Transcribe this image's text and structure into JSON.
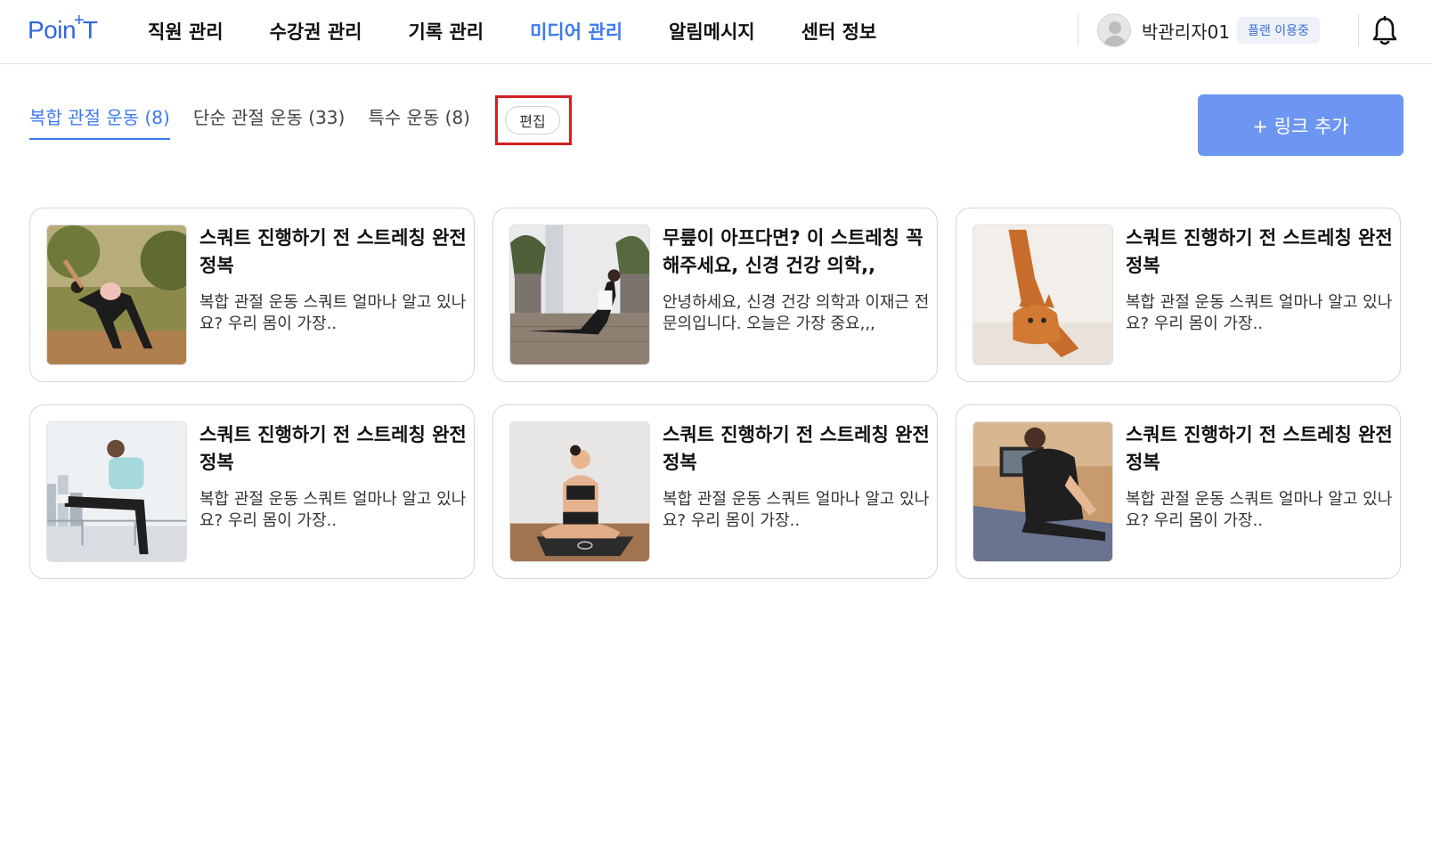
{
  "header": {
    "logo": {
      "left": "Poin",
      "plus": "+",
      "right": "T"
    },
    "nav": [
      {
        "label": "직원 관리",
        "active": false
      },
      {
        "label": "수강권 관리",
        "active": false
      },
      {
        "label": "기록 관리",
        "active": false
      },
      {
        "label": "미디어 관리",
        "active": true
      },
      {
        "label": "알림메시지",
        "active": false
      },
      {
        "label": "센터 정보",
        "active": false
      }
    ],
    "user": {
      "name": "박관리자01",
      "plan_badge": "플랜 이용중"
    }
  },
  "tabs": [
    {
      "label": "복합 관절 운동 (8)",
      "active": true
    },
    {
      "label": "단순 관절 운동 (33)",
      "active": false
    },
    {
      "label": "특수 운동 (8)",
      "active": false
    }
  ],
  "edit_button": "편집",
  "add_link_button": "+ 링크 추가",
  "cards": [
    {
      "title": "스쿼트 진행하기 전 스트레칭 완전 정복",
      "desc": "복합 관절 운동 스쿼트 얼마나 알고 있나요? 우리 몸이 가장..",
      "image": "woman side stretch outdoors"
    },
    {
      "title": "무릎이 아프다면? 이 스트레칭 꼭 해주세요, 신경 건강 의학,,",
      "desc": "안녕하세요, 신경 건강 의학과 이재근 전문의입니다. 오늘은 가장 중요,,,",
      "image": "woman cobra pose on deck"
    },
    {
      "title": "스쿼트 진행하기 전 스트레칭 완전 정복",
      "desc": "복합 관절 운동 스쿼트 얼마나 알고 있나요? 우리 몸이 가장..",
      "image": "orange cat stretching"
    },
    {
      "title": "스쿼트 진행하기 전 스트레칭 완전 정복",
      "desc": "복합 관절 운동 스쿼트 얼마나 알고 있나요? 우리 몸이 가장..",
      "image": "man stretching leg on rail"
    },
    {
      "title": "스쿼트 진행하기 전 스트레칭 완전 정복",
      "desc": "복합 관절 운동 스쿼트 얼마나 알고 있나요? 우리 몸이 가장..",
      "image": "woman seated on yoga mat"
    },
    {
      "title": "스쿼트 진행하기 전 스트레칭 완전 정복",
      "desc": "복합 관절 운동 스쿼트 얼마나 알고 있나요? 우리 몸이 가장..",
      "image": "woman stretching on mat from behind"
    }
  ],
  "colors": {
    "accent": "#3d7af0",
    "button": "#6c96f2",
    "highlight": "#d32020"
  }
}
